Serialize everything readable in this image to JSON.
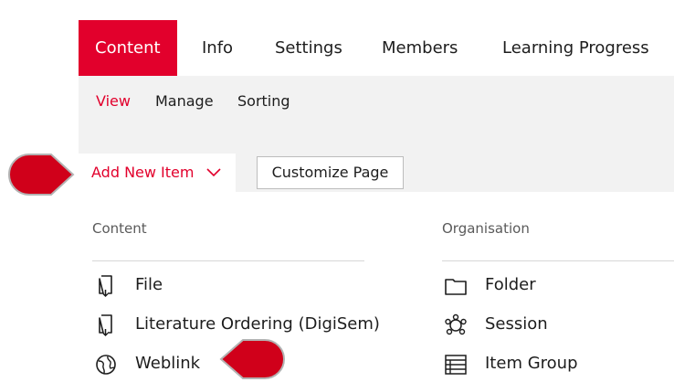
{
  "tabs": [
    {
      "label": "Content",
      "active": true
    },
    {
      "label": "Info",
      "active": false
    },
    {
      "label": "Settings",
      "active": false
    },
    {
      "label": "Members",
      "active": false
    },
    {
      "label": "Learning Progress",
      "active": false
    }
  ],
  "subtabs": [
    {
      "label": "View",
      "active": true
    },
    {
      "label": "Manage",
      "active": false
    },
    {
      "label": "Sorting",
      "active": false
    }
  ],
  "toolbar": {
    "add_new_item_label": "Add New Item",
    "customize_page_label": "Customize Page"
  },
  "dropdown": {
    "content_header": "Content",
    "organisation_header": "Organisation",
    "content_items": [
      {
        "label": "File",
        "icon": "file-icon"
      },
      {
        "label": "Literature Ordering (DigiSem)",
        "icon": "file-icon"
      },
      {
        "label": "Weblink",
        "icon": "globe-icon"
      }
    ],
    "organisation_items": [
      {
        "label": "Folder",
        "icon": "folder-icon"
      },
      {
        "label": "Session",
        "icon": "session-icon"
      },
      {
        "label": "Item Group",
        "icon": "item-group-icon"
      }
    ]
  },
  "colors": {
    "accent": "#e2002c",
    "pointer_red": "#d0001a",
    "background_gray": "#f2f2f2"
  }
}
